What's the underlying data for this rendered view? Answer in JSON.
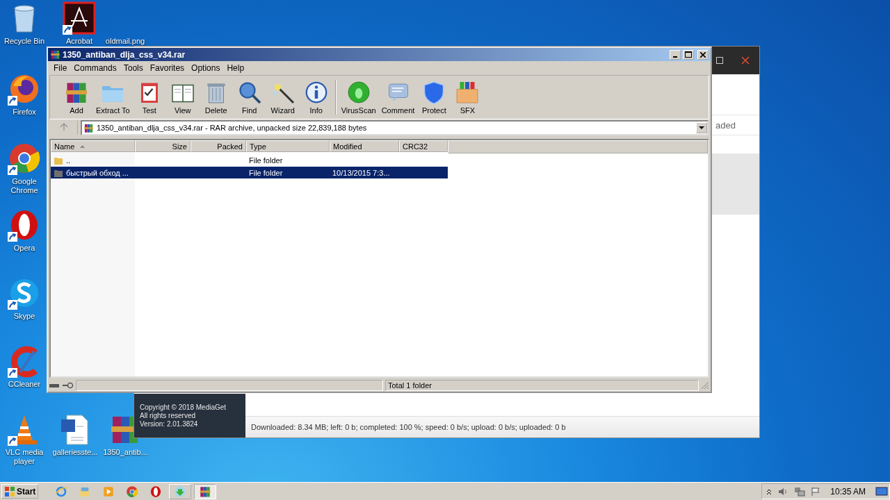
{
  "desktop_icons": [
    {
      "label": "Recycle Bin",
      "shortcut": false
    },
    {
      "label": "Acrobat",
      "shortcut": true
    },
    {
      "label": "oldmail.png",
      "shortcut": false
    },
    {
      "label": "Firefox",
      "shortcut": true
    },
    {
      "label": "Google Chrome",
      "shortcut": true
    },
    {
      "label": "Opera",
      "shortcut": true
    },
    {
      "label": "Skype",
      "shortcut": true
    },
    {
      "label": "CCleaner",
      "shortcut": true
    },
    {
      "label": "VLC media player",
      "shortcut": true
    },
    {
      "label": "galleriesste...",
      "shortcut": false
    },
    {
      "label": "1350_antib...",
      "shortcut": false
    }
  ],
  "mediaget": {
    "partial_column": "aded",
    "tooltip": [
      "Copyright © 2018 MediaGet",
      "All rights reserved",
      "Version: 2.01.3824"
    ],
    "status": "Downloaded: 8.34 MB; left: 0 b; completed: 100 %; speed: 0 b/s; upload: 0 b/s; uploaded: 0 b"
  },
  "window": {
    "title": "1350_antiban_dlja_css_v34.rar",
    "menu": [
      "File",
      "Commands",
      "Tools",
      "Favorites",
      "Options",
      "Help"
    ],
    "toolbar": [
      "Add",
      "Extract To",
      "Test",
      "View",
      "Delete",
      "Find",
      "Wizard",
      "Info",
      "VirusScan",
      "Comment",
      "Protect",
      "SFX"
    ],
    "address": "1350_antiban_dlja_css_v34.rar - RAR archive, unpacked size 22,839,188 bytes",
    "columns": [
      {
        "label": "Name",
        "sorted": true
      },
      {
        "label": "Size",
        "sorted": false
      },
      {
        "label": "Packed",
        "sorted": false
      },
      {
        "label": "Type",
        "sorted": false
      },
      {
        "label": "Modified",
        "sorted": false
      },
      {
        "label": "CRC32",
        "sorted": false
      }
    ],
    "rows": [
      {
        "name": "..",
        "type": "File folder",
        "selected": false
      },
      {
        "name": "быстрый обход ...",
        "type": "File folder",
        "modified": "10/13/2015 7:3...",
        "selected": true
      }
    ],
    "status": "Total 1 folder"
  },
  "taskbar": {
    "start": "Start",
    "tasks": [
      {
        "selected": false
      },
      {
        "selected": true
      }
    ],
    "clock": "10:35 AM"
  }
}
